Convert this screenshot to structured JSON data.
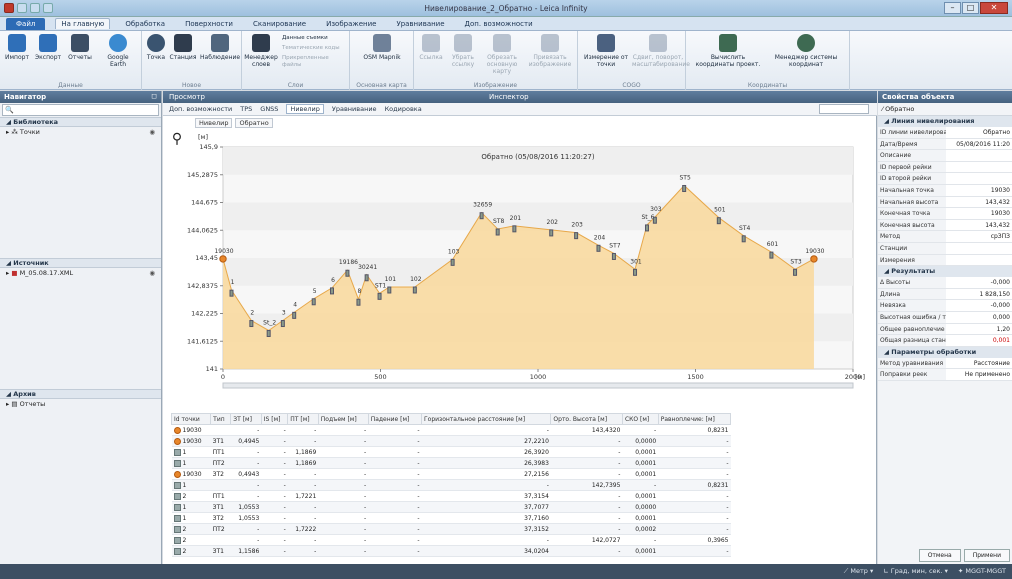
{
  "window": {
    "title": "Нивелирование_2_Обратно - Leica Infinity"
  },
  "ribbon_tabs": [
    {
      "label": "Файл"
    },
    {
      "label": "На главную"
    },
    {
      "label": "Обработка"
    },
    {
      "label": "Поверхности"
    },
    {
      "label": "Сканирование"
    },
    {
      "label": "Изображение"
    },
    {
      "label": "Уравнивание"
    },
    {
      "label": "Доп. возможности"
    }
  ],
  "ribbon": {
    "data": {
      "caption": "Данные",
      "import": "Импорт",
      "export": "Экспорт",
      "reports": "Отчеты",
      "google": "Google Earth"
    },
    "new": {
      "caption": "Новое",
      "point": "Точка",
      "station": "Станция",
      "observation": "Наблюдение"
    },
    "layers": {
      "caption": "Слои",
      "manager": "Менеджер слоев",
      "survey": "Данные съемки",
      "thematic": "Тематические коды",
      "attached": "Прикрепленные файлы"
    },
    "basemap": {
      "caption": "Основная карта",
      "osm": "OSM Mapnik"
    },
    "image": {
      "caption": "Изображение",
      "link": "Ссылка",
      "remove": "Убрать ссылку",
      "crop": "Обрезать основную карту",
      "attach": "Привязать изображение"
    },
    "cogo": {
      "caption": "COGO",
      "measure": "Измерение от точки",
      "shift": "Сдвиг, поворот, масштабирование"
    },
    "coords": {
      "caption": "Координаты",
      "compute": "Вычислить координаты проект.",
      "manager": "Менеджер системы координат"
    }
  },
  "navigator": {
    "title": "Навигатор",
    "search_placeholder": "",
    "library": "Библиотека",
    "points": "Точки",
    "sources": "Источник",
    "file": "M_05.08.17.XML",
    "archive": "Архив",
    "reports": "Отчеты"
  },
  "center": {
    "tab_view": "Просмотр",
    "tab_inspector": "Инспектор",
    "subtabs": [
      "Доп. возможности",
      "TPS",
      "GNSS",
      "Нивелир",
      "Уравнивание",
      "Кодировка"
    ],
    "crumb": [
      "Нивелир",
      "Обратно"
    ]
  },
  "chart_data": {
    "type": "area",
    "title": "Обратно (05/08/2016 11:20:27)",
    "ylabel": "[м]",
    "xlabel": "[м]",
    "ylim": [
      141,
      145.9
    ],
    "xlim": [
      0,
      2000
    ],
    "yticks": [
      "145,9",
      "145,2875",
      "144,675",
      "144,0625",
      "143,45",
      "142,8375",
      "142,225",
      "141,6125",
      "141"
    ],
    "xticks": [
      "0",
      "500",
      "1000",
      "1500",
      "2000"
    ],
    "points": [
      {
        "x": 0,
        "y": 143.43,
        "label": "19030"
      },
      {
        "x": 27,
        "y": 142.74,
        "label": "1"
      },
      {
        "x": 90,
        "y": 142.07,
        "label": "2"
      },
      {
        "x": 145,
        "y": 141.85,
        "label": "St_2"
      },
      {
        "x": 190,
        "y": 142.07,
        "label": "3"
      },
      {
        "x": 226,
        "y": 142.25,
        "label": "4"
      },
      {
        "x": 288,
        "y": 142.55,
        "label": "5"
      },
      {
        "x": 346,
        "y": 142.79,
        "label": "6"
      },
      {
        "x": 395,
        "y": 143.18,
        "label": "19186"
      },
      {
        "x": 430,
        "y": 142.54,
        "label": "8"
      },
      {
        "x": 456,
        "y": 143.08,
        "label": "30241"
      },
      {
        "x": 497,
        "y": 142.67,
        "label": "ST1"
      },
      {
        "x": 528,
        "y": 142.81,
        "label": "101"
      },
      {
        "x": 609,
        "y": 142.81,
        "label": "102"
      },
      {
        "x": 729,
        "y": 143.42,
        "label": "103"
      },
      {
        "x": 821,
        "y": 144.45,
        "label": "32659"
      },
      {
        "x": 872,
        "y": 144.09,
        "label": "ST8"
      },
      {
        "x": 925,
        "y": 144.16,
        "label": "201"
      },
      {
        "x": 1042,
        "y": 144.07,
        "label": "202"
      },
      {
        "x": 1121,
        "y": 144.01,
        "label": "203"
      },
      {
        "x": 1192,
        "y": 143.73,
        "label": "204"
      },
      {
        "x": 1241,
        "y": 143.55,
        "label": "ST7"
      },
      {
        "x": 1308,
        "y": 143.2,
        "label": "301"
      },
      {
        "x": 1346,
        "y": 144.18,
        "label": "St_6"
      },
      {
        "x": 1371,
        "y": 144.35,
        "label": "303"
      },
      {
        "x": 1464,
        "y": 145.05,
        "label": "ST5"
      },
      {
        "x": 1574,
        "y": 144.34,
        "label": "501"
      },
      {
        "x": 1653,
        "y": 143.94,
        "label": "ST4"
      },
      {
        "x": 1741,
        "y": 143.58,
        "label": "601"
      },
      {
        "x": 1816,
        "y": 143.2,
        "label": "ST3"
      },
      {
        "x": 1876,
        "y": 143.43,
        "label": "19030"
      }
    ]
  },
  "table": {
    "headers": [
      "Id точки",
      "Тип",
      "ЗТ [м]",
      "IS [м]",
      "ПТ [м]",
      "Подъем [м]",
      "Падение [м]",
      "Горизонтальное расстояние [м]",
      "Орто. Высота [м]",
      "СКО [м]",
      "Равноплечие: [м]"
    ],
    "rows": [
      [
        "19030",
        "",
        "-",
        "-",
        "-",
        "-",
        "-",
        "-",
        "143,4320",
        "-",
        "0,8231"
      ],
      [
        "19030",
        "ЗТ1",
        "0,4945",
        "-",
        "-",
        "-",
        "-",
        "27,2210",
        "-",
        "0,0000",
        "-"
      ],
      [
        "1",
        "ПТ1",
        "-",
        "-",
        "1,1869",
        "-",
        "-",
        "26,3920",
        "-",
        "0,0001",
        "-"
      ],
      [
        "1",
        "ПТ2",
        "-",
        "-",
        "1,1869",
        "-",
        "-",
        "26,3983",
        "-",
        "0,0001",
        "-"
      ],
      [
        "19030",
        "ЗТ2",
        "0,4943",
        "-",
        "-",
        "-",
        "-",
        "27,2156",
        "-",
        "0,0001",
        "-"
      ],
      [
        "1",
        "",
        "-",
        "-",
        "-",
        "-",
        "-",
        "-",
        "142,7395",
        "-",
        "0,8231"
      ],
      [
        "2",
        "ПТ1",
        "-",
        "-",
        "1,7221",
        "-",
        "-",
        "37,3154",
        "-",
        "0,0001",
        "-"
      ],
      [
        "1",
        "ЗТ1",
        "1,0553",
        "-",
        "-",
        "-",
        "-",
        "37,7077",
        "-",
        "0,0000",
        "-"
      ],
      [
        "1",
        "ЗТ2",
        "1,0553",
        "-",
        "-",
        "-",
        "-",
        "37,7160",
        "-",
        "0,0001",
        "-"
      ],
      [
        "2",
        "ПТ2",
        "-",
        "-",
        "1,7222",
        "-",
        "-",
        "37,3152",
        "-",
        "0,0002",
        "-"
      ],
      [
        "2",
        "",
        "-",
        "-",
        "-",
        "-",
        "-",
        "-",
        "142,0727",
        "-",
        "0,3965"
      ],
      [
        "2",
        "ЗТ1",
        "1,1586",
        "-",
        "-",
        "-",
        "-",
        "34,0204",
        "-",
        "0,0001",
        "-"
      ]
    ]
  },
  "props": {
    "title": "Свойства объекта",
    "object": "Обратно",
    "section_line": "Линия нивелирования",
    "rows": [
      [
        "ID линии нивелирова",
        "Обратно"
      ],
      [
        "Дата/Время",
        "05/08/2016 11:20"
      ],
      [
        "Описание",
        ""
      ],
      [
        "ID первой рейки",
        ""
      ],
      [
        "ID второй рейки",
        ""
      ],
      [
        "Начальная точка",
        "19030"
      ],
      [
        "Начальная высота",
        "143,432"
      ],
      [
        "Конечная точка",
        "19030"
      ],
      [
        "Конечная высота",
        "143,432"
      ],
      [
        "Метод",
        "срЗПЗ"
      ],
      [
        "Станции",
        ""
      ],
      [
        "Измерения",
        ""
      ]
    ],
    "section_results": "Результаты",
    "results": [
      [
        "Δ Высоты",
        "-0,000"
      ],
      [
        "Длина",
        "1 828,150"
      ],
      [
        "Невязка",
        "-0,000"
      ],
      [
        "Высотная ошибка / то",
        "0,000"
      ],
      [
        "Общее равноплечие",
        "1,20"
      ],
      [
        "Общая разница станц",
        "0,001"
      ]
    ],
    "section_params": "Параметры обработки",
    "params": [
      [
        "Метод уравнивания",
        "Расстояние"
      ],
      [
        "Поправки реек",
        "Не применено"
      ]
    ],
    "cancel": "Отмена",
    "apply": "Примени"
  },
  "status": {
    "units": "Метр",
    "angle": "Град, мин, сек.",
    "cs": "MGGT-MGGT"
  }
}
